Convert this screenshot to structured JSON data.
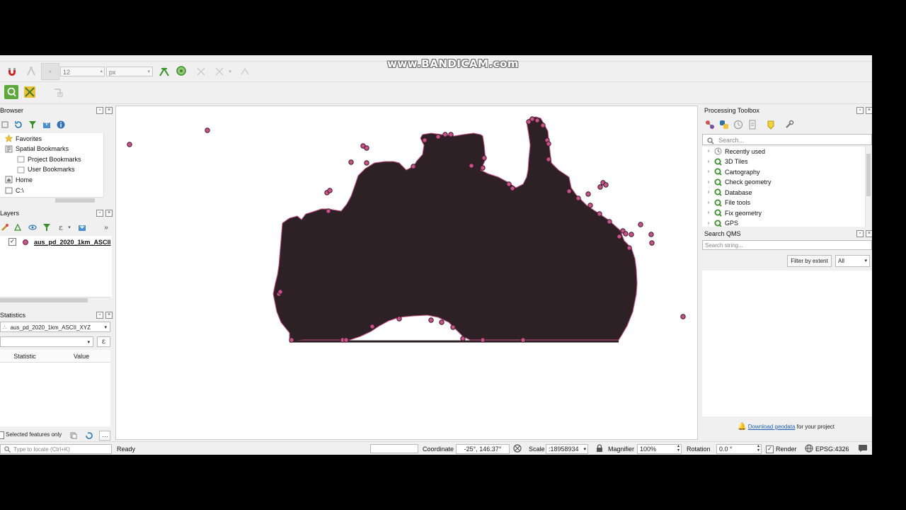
{
  "watermark": "www.BANDICAM.com",
  "toolbar": {
    "size_value": "12",
    "unit_value": "px"
  },
  "browser": {
    "title": "Browser",
    "items": [
      {
        "label": "Favorites",
        "icon": "star-icon",
        "indent": 0
      },
      {
        "label": "Spatial Bookmarks",
        "icon": "bookmark-icon",
        "indent": 0
      },
      {
        "label": "Project Bookmarks",
        "icon": "folder-icon",
        "indent": 1
      },
      {
        "label": "User Bookmarks",
        "icon": "folder-icon",
        "indent": 1
      },
      {
        "label": "Home",
        "icon": "home-icon",
        "indent": 0
      },
      {
        "label": "C:\\",
        "icon": "drive-icon",
        "indent": 0
      }
    ]
  },
  "layers": {
    "title": "Layers",
    "layer_name": "aus_pd_2020_1km_ASCII",
    "checked": true
  },
  "statistics": {
    "title": "Statistics",
    "layer_select": "aus_pd_2020_1km_ASCII_XYZ",
    "col_statistic": "Statistic",
    "col_value": "Value",
    "selected_only": "Selected features only"
  },
  "locator": {
    "placeholder": "Type to locate (Ctrl+K)"
  },
  "processing": {
    "title": "Processing Toolbox",
    "search_placeholder": "Search...",
    "items": [
      "Recently used",
      "3D Tiles",
      "Cartography",
      "Check geometry",
      "Database",
      "File tools",
      "Fix geometry",
      "GPS"
    ]
  },
  "qms": {
    "title": "Search QMS",
    "search_placeholder": "Search string...",
    "filter_button": "Filter by extent",
    "filter_select": "All",
    "download_link": "Download geodata",
    "download_suffix": "for your project"
  },
  "statusbar": {
    "ready": "Ready",
    "coordinate_label": "Coordinate",
    "coordinate_value": "-25°, 146.37°",
    "scale_label": "Scale",
    "scale_value": ":18958934",
    "magnifier_label": "Magnifier",
    "magnifier_value": "100%",
    "rotation_label": "Rotation",
    "rotation_value": "0.0 °",
    "render_label": "Render",
    "crs": "EPSG:4326"
  },
  "colors": {
    "landmass": "#2e2126",
    "point": "#c7538a",
    "accent_green": "#3a8f2c"
  }
}
